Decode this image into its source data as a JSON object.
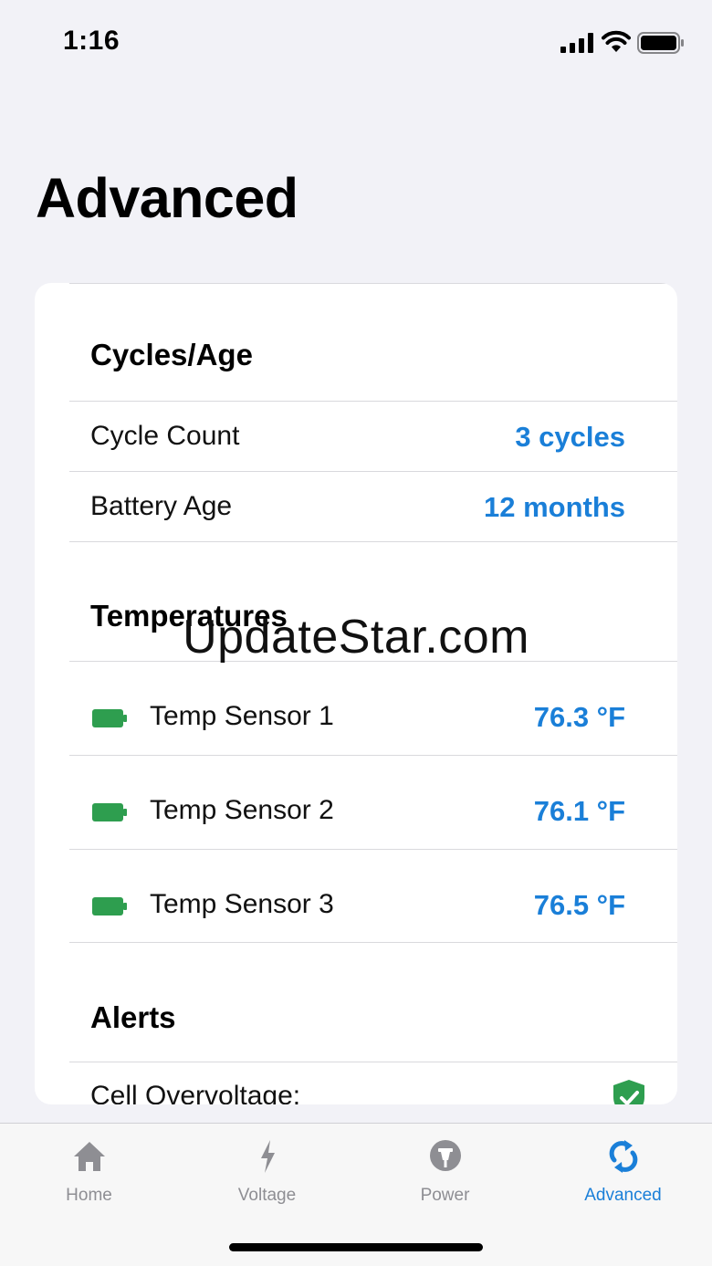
{
  "status_bar": {
    "time": "1:16"
  },
  "page_title": "Advanced",
  "cycles_age": {
    "header": "Cycles/Age",
    "rows": [
      {
        "label": "Cycle Count",
        "value": "3 cycles"
      },
      {
        "label": "Battery Age",
        "value": "12 months"
      }
    ]
  },
  "temperatures": {
    "header": "Temperatures",
    "rows": [
      {
        "icon": "battery-icon",
        "label": "Temp Sensor 1",
        "value": "76.3 °F"
      },
      {
        "icon": "battery-icon",
        "label": "Temp Sensor 2",
        "value": "76.1 °F"
      },
      {
        "icon": "battery-icon",
        "label": "Temp Sensor 3",
        "value": "76.5 °F"
      }
    ]
  },
  "alerts": {
    "header": "Alerts",
    "rows": [
      {
        "label": "Cell Overvoltage:",
        "icon": "shield-check-icon"
      }
    ]
  },
  "watermark": "UpdateStar.com",
  "tab_bar": {
    "tabs": [
      {
        "label": "Home",
        "icon": "house-icon",
        "active": false
      },
      {
        "label": "Voltage",
        "icon": "bolt-icon",
        "active": false
      },
      {
        "label": "Power",
        "icon": "power-plug-icon",
        "active": false
      },
      {
        "label": "Advanced",
        "icon": "refresh-icon",
        "active": true
      }
    ]
  },
  "colors": {
    "accent": "#1a7fd8",
    "battery_green": "#2e9e4f",
    "inactive_tab": "#8e8e93",
    "background": "#f2f2f7"
  }
}
